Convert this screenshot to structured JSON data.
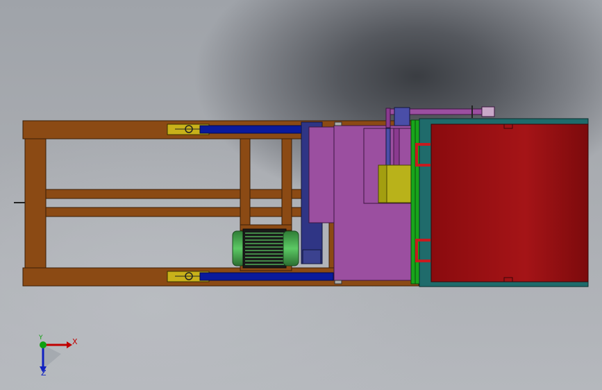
{
  "viewport": {
    "background": [
      "#8f9399",
      "#3a3d42",
      "#b5b8bd"
    ]
  },
  "model": {
    "frame_color": "#8b4a14",
    "frame_edge": "#3b1e06",
    "cylinder_color": "#0a1a9c",
    "mount_color": "#c8b11a",
    "motor_color": "#4caf50",
    "panel_purple": "#9b4fa0",
    "panel_dark": "#2a2f78",
    "yellow_block": "#b9b21a",
    "green_plate": "#18a51b",
    "bin_red": "#9a0f12",
    "bin_teal": "#1f6b6b",
    "clip_red": "#c61b1f"
  },
  "triad": {
    "x_label": "X",
    "y_label": "Y",
    "z_label": "Z",
    "x_color": "#c00000",
    "y_color": "#10a010",
    "z_color": "#1020c0"
  }
}
